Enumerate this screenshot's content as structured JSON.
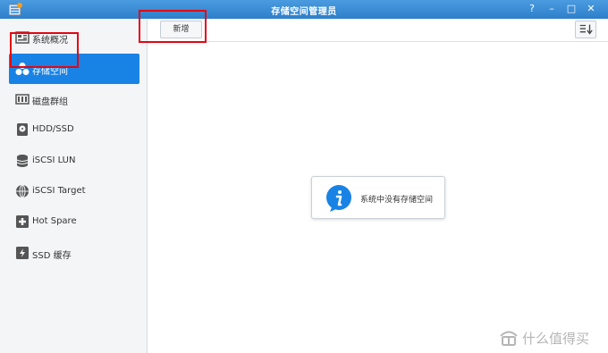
{
  "window": {
    "title": "存储空间管理员",
    "controls": [
      "?",
      "–",
      "□",
      "✕"
    ]
  },
  "sidebar": {
    "items": [
      {
        "label": "系统概况",
        "icon": "overview-icon"
      },
      {
        "label": "存储空间",
        "icon": "storage-volume-icon",
        "active": true
      },
      {
        "label": "磁盘群组",
        "icon": "disk-group-icon"
      },
      {
        "label": "HDD/SSD",
        "icon": "hdd-icon"
      },
      {
        "label": "iSCSI LUN",
        "icon": "iscsi-lun-icon"
      },
      {
        "label": "iSCSI Target",
        "icon": "iscsi-target-icon"
      },
      {
        "label": "Hot Spare",
        "icon": "hot-spare-icon"
      },
      {
        "label": "SSD 缓存",
        "icon": "ssd-cache-icon"
      }
    ]
  },
  "toolbar": {
    "new_label": "新增",
    "sort_icon": "sort-icon"
  },
  "content": {
    "empty_message": "系统中没有存储空间"
  },
  "watermark": {
    "text": "什么值得买"
  },
  "colors": {
    "accent": "#1883e5",
    "titlebar": "#3a8ed6",
    "highlight": "#e30613"
  }
}
